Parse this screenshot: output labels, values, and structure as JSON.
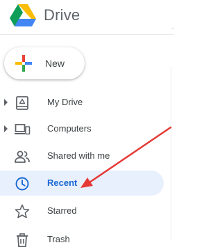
{
  "app": {
    "title": "Drive"
  },
  "new_button": {
    "label": "New",
    "icon": "plus-multicolor-icon"
  },
  "nav": {
    "items": [
      {
        "label": "My Drive",
        "icon": "my-drive-icon",
        "expandable": true,
        "active": false
      },
      {
        "label": "Computers",
        "icon": "computers-icon",
        "expandable": true,
        "active": false
      },
      {
        "label": "Shared with me",
        "icon": "shared-with-me-icon",
        "expandable": false,
        "active": false
      },
      {
        "label": "Recent",
        "icon": "clock-icon",
        "expandable": false,
        "active": true
      },
      {
        "label": "Starred",
        "icon": "star-icon",
        "expandable": false,
        "active": false
      },
      {
        "label": "Trash",
        "icon": "trash-icon",
        "expandable": false,
        "active": false
      }
    ]
  },
  "annotation": {
    "type": "arrow",
    "color": "#e53935",
    "points_to": "Recent"
  },
  "colors": {
    "accent": "#1967d2",
    "active_background": "#e8f0fe",
    "text": "#3c4043",
    "icon": "#5f6368"
  }
}
